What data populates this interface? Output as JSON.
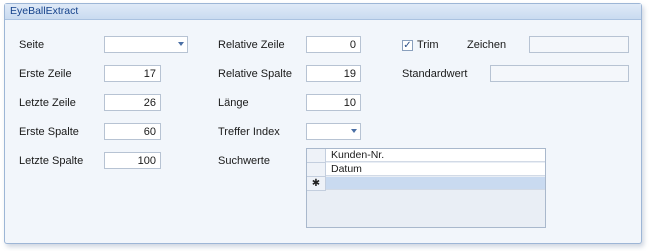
{
  "window": {
    "title": "EyeBallExtract"
  },
  "labels": {
    "seite": "Seite",
    "erste_zeile": "Erste Zeile",
    "letzte_zeile": "Letzte Zeile",
    "erste_spalte": "Erste Spalte",
    "letzte_spalte": "Letzte Spalte",
    "relative_zeile": "Relative Zeile",
    "relative_spalte": "Relative Spalte",
    "laenge": "Länge",
    "treffer_index": "Treffer Index",
    "suchwerte": "Suchwerte",
    "trim": "Trim",
    "zeichen": "Zeichen",
    "standardwert": "Standardwert"
  },
  "values": {
    "seite": "",
    "erste_zeile": "17",
    "letzte_zeile": "26",
    "erste_spalte": "60",
    "letzte_spalte": "100",
    "relative_zeile": "0",
    "relative_spalte": "19",
    "laenge": "10",
    "treffer_index": "",
    "zeichen": "",
    "standardwert": ""
  },
  "trim_checked": true,
  "trim_check_glyph": "✓",
  "suchwerte_rows": [
    "Kunden-Nr.",
    "Datum"
  ],
  "new_row_marker": "✱",
  "colors": {
    "title_text": "#15428b",
    "panel_bg": "#f2f6fb",
    "selected_row": "#c9daf0"
  }
}
